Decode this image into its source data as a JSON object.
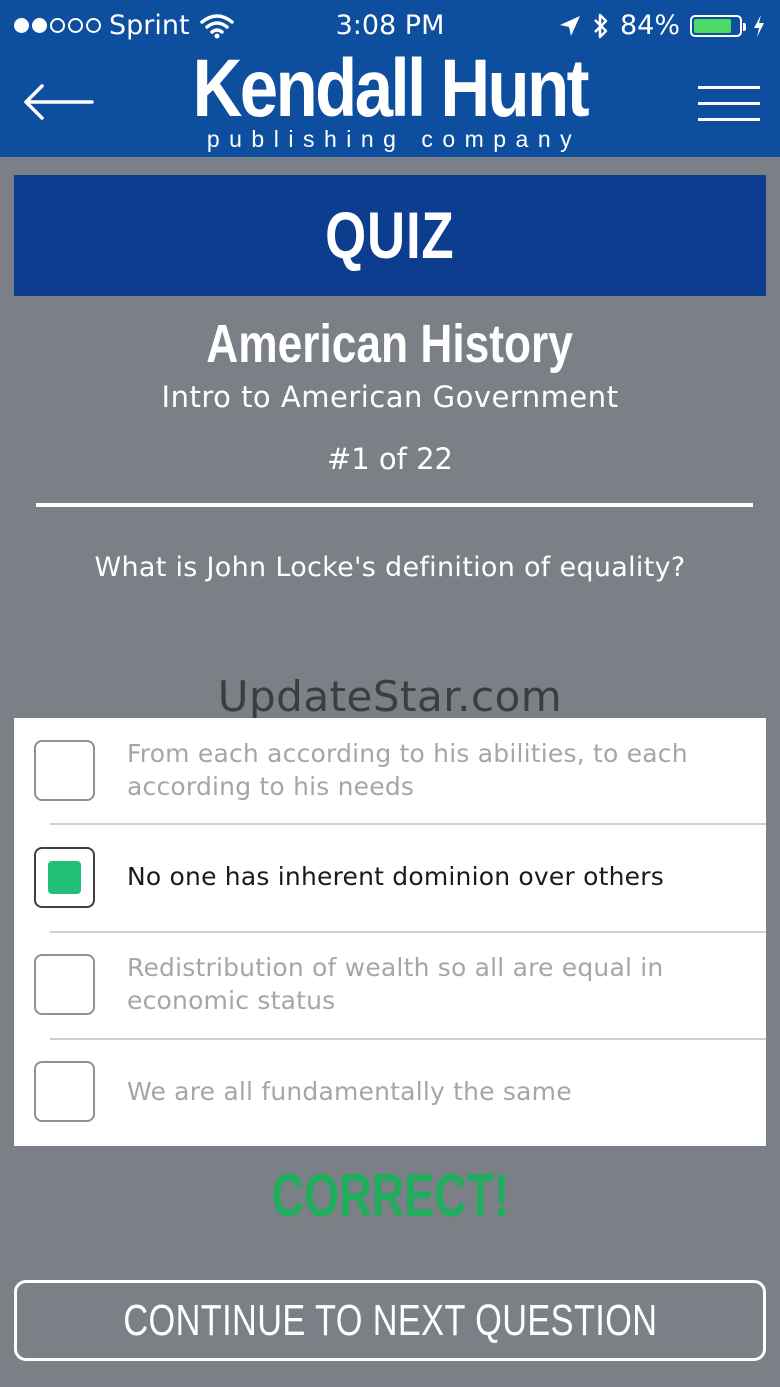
{
  "status_bar": {
    "carrier": "Sprint",
    "signal_bars_filled": 2,
    "signal_bars_total": 5,
    "time": "3:08 PM",
    "battery_percent_label": "84%",
    "battery_level": 0.84
  },
  "header": {
    "logo_main": "Kendall Hunt",
    "logo_sub": "publishing company",
    "back_icon": "arrow-left-icon",
    "menu_icon": "hamburger-menu-icon"
  },
  "quiz": {
    "banner": "QUIZ",
    "course": "American History",
    "subtitle": "Intro to American Government",
    "counter": "#1 of 22",
    "question": "What is John Locke's definition of equality?",
    "answers": [
      {
        "text": "From each according to his abilities, to each according to his needs",
        "selected": false
      },
      {
        "text": "No one has inherent dominion over others",
        "selected": true
      },
      {
        "text": "Redistribution of wealth so all are equal in economic status",
        "selected": false
      },
      {
        "text": "We are all fundamentally the same",
        "selected": false
      }
    ],
    "result": "CORRECT!",
    "continue_label": "CONTINUE TO NEXT QUESTION"
  },
  "watermark": "UpdateStar.com",
  "colors": {
    "header_blue": "#0d4e9e",
    "banner_blue": "#0c3d8f",
    "background_gray": "#7b7f86",
    "correct_green": "#1fae5d",
    "check_green": "#22bf77",
    "battery_green": "#4cd964"
  }
}
